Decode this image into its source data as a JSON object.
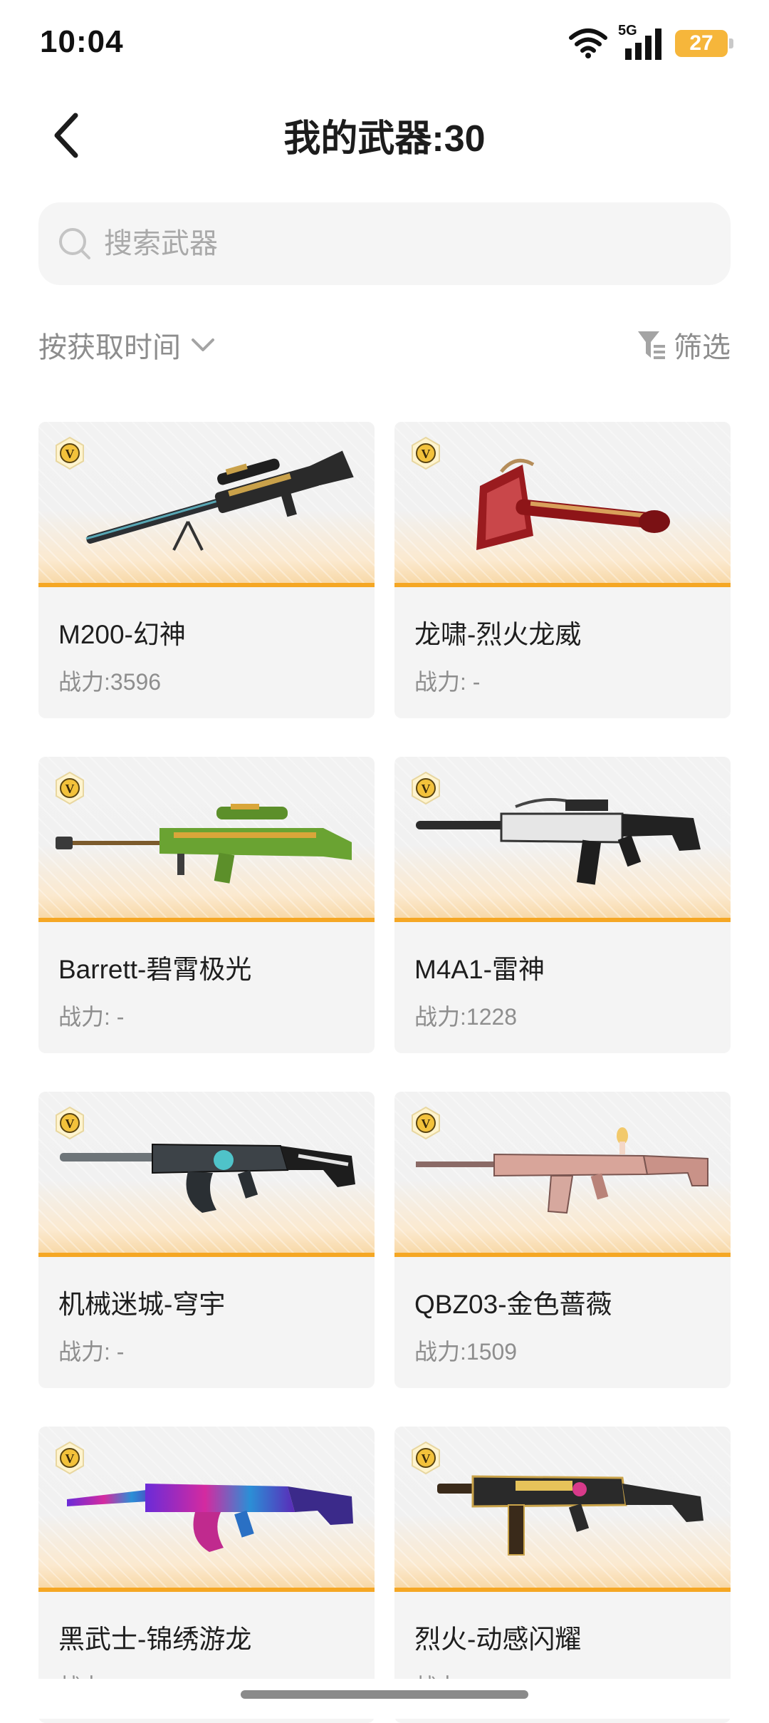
{
  "status_bar": {
    "time": "10:04",
    "network": "5G",
    "battery": "27",
    "icons": [
      "wifi-icon",
      "signal-icon",
      "battery-icon"
    ]
  },
  "header": {
    "title": "我的武器:30",
    "back_icon": "chevron-left-icon"
  },
  "search": {
    "placeholder": "搜索武器",
    "value": ""
  },
  "toolbar": {
    "sort_label": "按获取时间",
    "filter_label": "筛选"
  },
  "colors": {
    "accent": "#f5a724",
    "card_bg": "#f4f4f4",
    "secondary_text": "#8e8e8e"
  },
  "weapons": [
    {
      "name": "M200-幻神",
      "power": "战力:3596",
      "badge": "V"
    },
    {
      "name": "龙啸-烈火龙威",
      "power": "战力: -",
      "badge": "V"
    },
    {
      "name": "Barrett-碧霄极光",
      "power": "战力: -",
      "badge": "V"
    },
    {
      "name": "M4A1-雷神",
      "power": "战力:1228",
      "badge": "V"
    },
    {
      "name": "机械迷城-穹宇",
      "power": "战力: -",
      "badge": "V"
    },
    {
      "name": "QBZ03-金色蔷薇",
      "power": "战力:1509",
      "badge": "V"
    },
    {
      "name": "黑武士-锦绣游龙",
      "power": "战力: -",
      "badge": "V"
    },
    {
      "name": "烈火-动感闪耀",
      "power": "战力: -",
      "badge": "V"
    }
  ]
}
